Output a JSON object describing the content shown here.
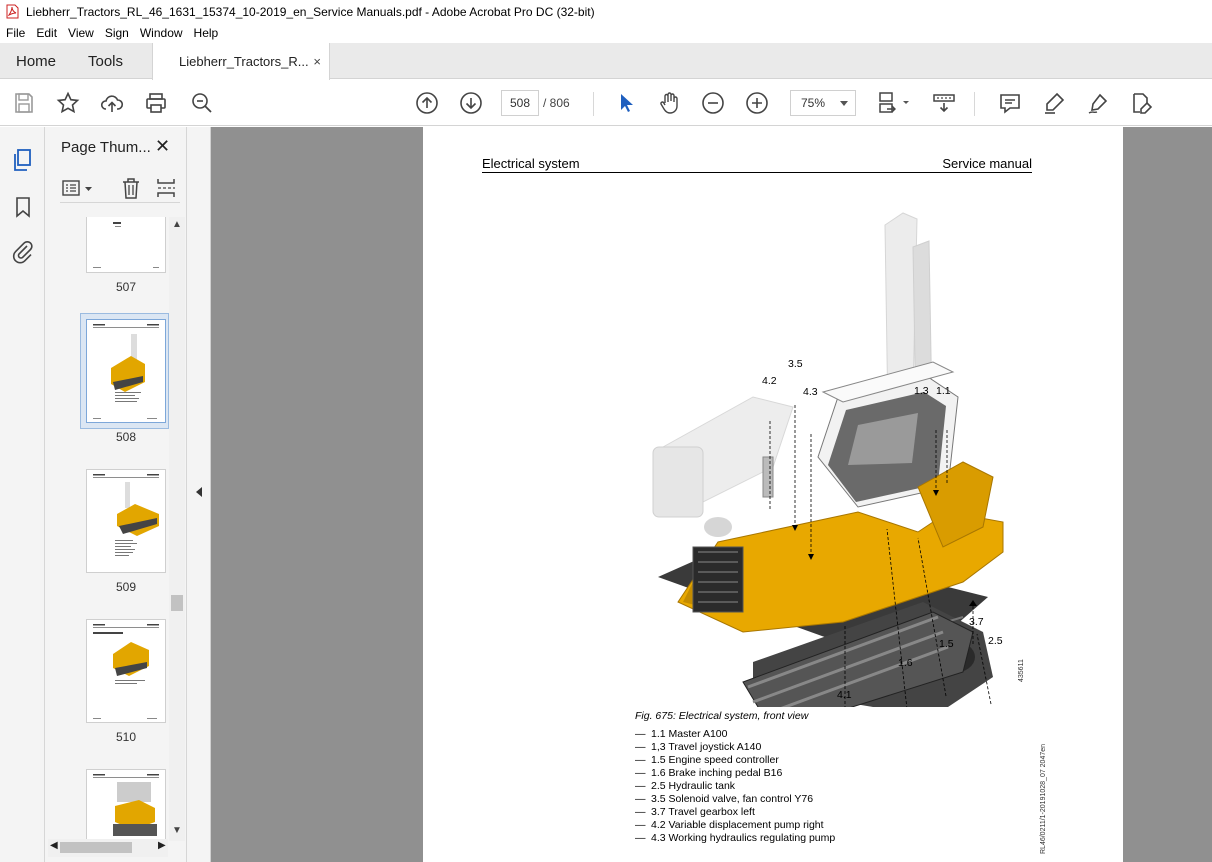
{
  "window": {
    "title": "Liebherr_Tractors_RL_46_1631_15374_10-2019_en_Service Manuals.pdf - Adobe Acrobat Pro DC (32-bit)"
  },
  "menu": [
    "File",
    "Edit",
    "View",
    "Sign",
    "Window",
    "Help"
  ],
  "tabs": {
    "home": "Home",
    "tools": "Tools",
    "document": "Liebherr_Tractors_R...",
    "close": "×"
  },
  "toolbar": {
    "page_current": "508",
    "page_total": "/ 806",
    "zoom": "75%"
  },
  "thumbnails": {
    "panel_title": "Page Thum...",
    "close": "✕",
    "pages": [
      "507",
      "508",
      "509",
      "510"
    ]
  },
  "document": {
    "header_left": "Electrical system",
    "header_right": "Service manual",
    "callouts": [
      "3.5",
      "4.2",
      "4.3",
      "1.3",
      "1.1",
      "3.7",
      "2.5",
      "1.5",
      "1.6",
      "4.1"
    ],
    "image_id": "435611",
    "footer_code": "RL46/0211/1-20191028_07 2047en",
    "caption": "Fig. 675: Electrical system, front view",
    "legend": [
      "1.1 Master A100",
      "1,3 Travel joystick A140",
      "1.5 Engine speed controller",
      "1.6 Brake inching pedal B16",
      "2.5 Hydraulic tank",
      "3.5 Solenoid valve, fan control Y76",
      "3.7 Travel gearbox left",
      "4.2 Variable displacement pump right",
      "4.3 Working hydraulics regulating pump"
    ],
    "legend_dash": "—"
  },
  "colors": {
    "machine_yellow": "#e8a800",
    "track_dark": "#3a3a3a",
    "acrobat_red": "#d4221c",
    "select_blue": "#2b6fc4"
  }
}
